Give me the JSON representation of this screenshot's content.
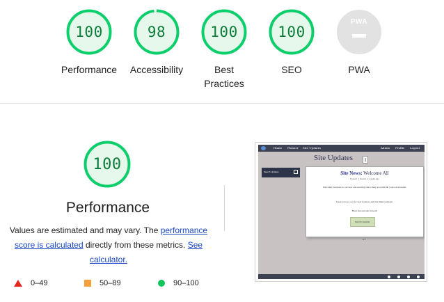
{
  "summary": {
    "gauges": [
      {
        "label": "Performance",
        "score": "100",
        "fraction": 1.0
      },
      {
        "label": "Accessibility",
        "score": "98",
        "fraction": 0.98
      },
      {
        "label": "Best Practices",
        "score": "100",
        "fraction": 1.0
      },
      {
        "label": "SEO",
        "score": "100",
        "fraction": 1.0
      }
    ],
    "pwa": {
      "label": "PWA",
      "badge_text": "PWA"
    }
  },
  "performance": {
    "score": "100",
    "fraction": 1.0,
    "title": "Performance",
    "desc_prefix": "Values are estimated and may vary. The ",
    "link1": "performance score is calculated",
    "desc_middle": " directly from these metrics. ",
    "link2": "See calculator."
  },
  "legend": [
    {
      "range": "0–49",
      "shape": "triangle",
      "color": "#e5281d"
    },
    {
      "range": "50–89",
      "shape": "square",
      "color": "#f5a03a"
    },
    {
      "range": "90–100",
      "shape": "circle",
      "color": "#11c45c"
    }
  ],
  "screenshot": {
    "nav_left": [
      "Home",
      "Planner",
      "Site Updates"
    ],
    "nav_right": [
      "Admin",
      "Profile",
      "Logout"
    ],
    "page_title": "Site Updates",
    "count": "1",
    "sidebar_search": "Search Updates",
    "card_title_bold": "Site News:",
    "card_title_rest": " Welcome All",
    "card_meta": "Posted: 1 month, 2 weeks ago",
    "card_p1": "Welcome everyone to our new and exciting site to help you with all your travel needs.",
    "card_p2": "Keep you eye out for new features and site improvements.",
    "card_p3": "Have fun and safe travels!",
    "card_image": "PHOTO DETAIL",
    "pager": "● 1"
  },
  "colors": {
    "pass": "#0cce6b",
    "pass_fill": "#e6f7ec",
    "pass_text": "#0b7d38",
    "link": "#1a47c7"
  }
}
